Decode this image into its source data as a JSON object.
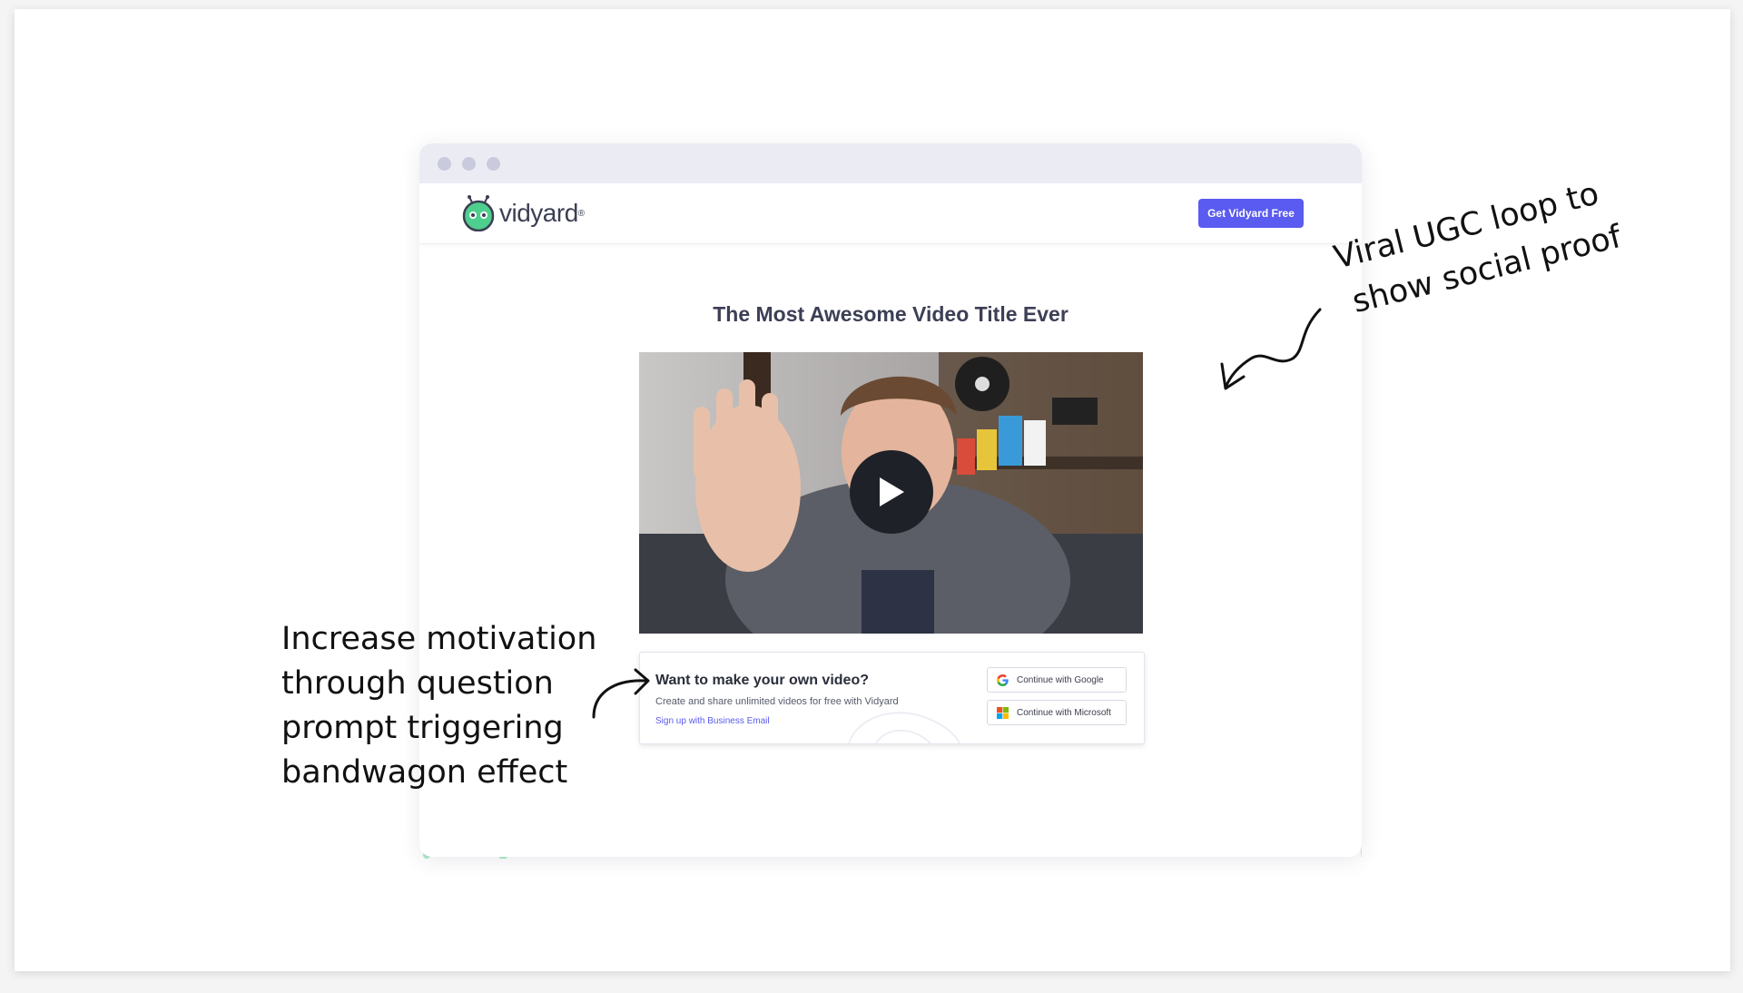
{
  "browser": {
    "logo": {
      "text": "vidyard",
      "registered": "®"
    },
    "cta_label": "Get Vidyard Free"
  },
  "page": {
    "title": "The Most Awesome Video Title Ever"
  },
  "prompt": {
    "heading": "Want to make your own video?",
    "subtext": "Create and share unlimited videos for free with Vidyard",
    "email_link": "Sign up with Business Email",
    "google_label": "Continue with Google",
    "microsoft_label": "Continue with Microsoft"
  },
  "annotations": {
    "right": [
      "Viral UGC loop to",
      "show social proof"
    ],
    "left": [
      "Increase motivation",
      "through question",
      "prompt triggering",
      "bandwagon effect"
    ]
  },
  "colors": {
    "accent": "#5a5bf0",
    "logo_green": "#4fcf8e",
    "title_text": "#3c3f55",
    "titlebar": "#ebecf3"
  },
  "icons": [
    "google-icon",
    "microsoft-icon",
    "play-icon",
    "vidyard-logo-icon"
  ]
}
